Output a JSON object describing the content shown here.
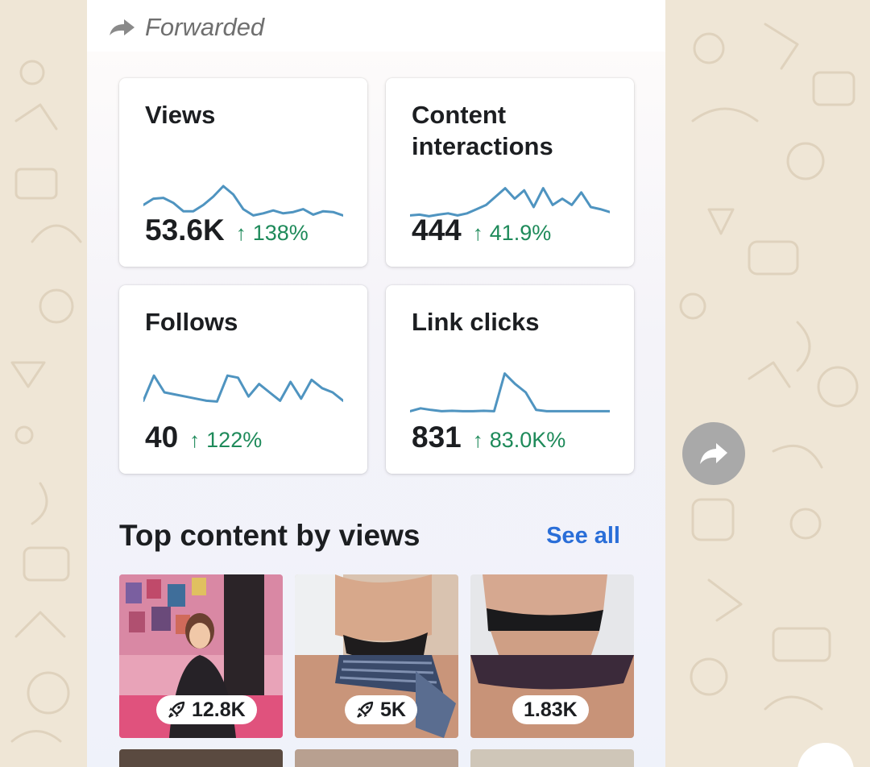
{
  "message": {
    "forwarded_label": "Forwarded"
  },
  "insights": {
    "cards": [
      {
        "title": "Views",
        "value": "53.6K",
        "change": "138%",
        "sparkline": [
          0.55,
          0.7,
          0.72,
          0.6,
          0.4,
          0.4,
          0.55,
          0.75,
          1.0,
          0.8,
          0.45,
          0.3,
          0.35,
          0.42,
          0.35,
          0.38,
          0.45,
          0.32,
          0.4,
          0.38,
          0.3
        ]
      },
      {
        "title": "Content interactions",
        "value": "444",
        "change": "41.9%",
        "sparkline": [
          0.3,
          0.32,
          0.28,
          0.32,
          0.35,
          0.3,
          0.35,
          0.45,
          0.55,
          0.75,
          0.95,
          0.7,
          0.9,
          0.5,
          0.95,
          0.55,
          0.7,
          0.55,
          0.85,
          0.5,
          0.45,
          0.38
        ]
      },
      {
        "title": "Follows",
        "value": "40",
        "change": "122%",
        "sparkline": [
          0.3,
          0.9,
          0.5,
          0.45,
          0.4,
          0.35,
          0.3,
          0.28,
          0.9,
          0.85,
          0.4,
          0.7,
          0.5,
          0.3,
          0.75,
          0.35,
          0.8,
          0.6,
          0.5,
          0.3
        ]
      },
      {
        "title": "Link clicks",
        "value": "831",
        "change": "83.0K%",
        "sparkline": [
          0.05,
          0.12,
          0.08,
          0.05,
          0.06,
          0.05,
          0.05,
          0.06,
          0.05,
          0.95,
          0.7,
          0.5,
          0.08,
          0.05,
          0.05,
          0.05,
          0.05,
          0.05,
          0.05,
          0.05
        ]
      }
    ],
    "top_content": {
      "title": "Top content by views",
      "see_all_label": "See all",
      "items": [
        {
          "views": "12.8K",
          "boosted": true
        },
        {
          "views": "5K",
          "boosted": true
        },
        {
          "views": "1.83K",
          "boosted": false
        }
      ]
    }
  },
  "colors": {
    "sparkline": "#4f94c0",
    "positive_change": "#1e8a5a",
    "link": "#2a6ed8",
    "wallpaper": "#efe6d6"
  }
}
